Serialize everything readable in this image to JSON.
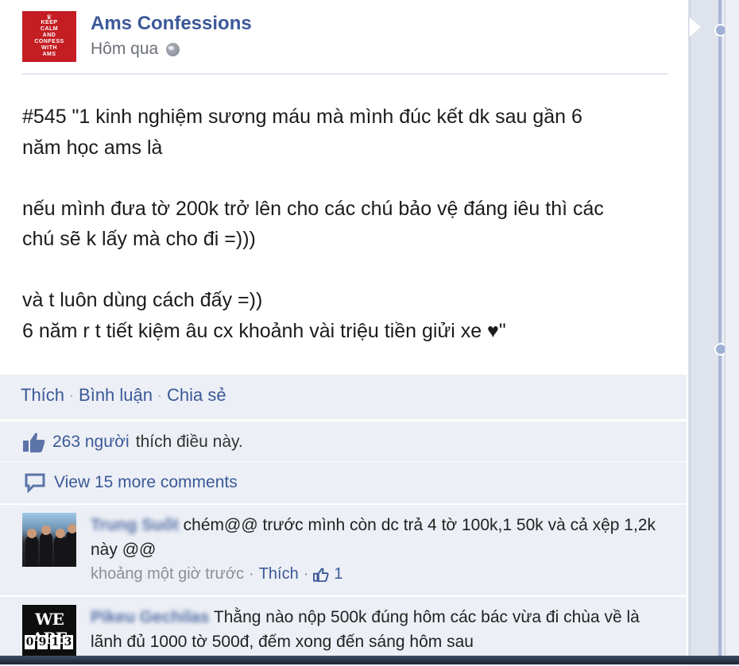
{
  "post": {
    "page_name": "Ams Confessions",
    "timestamp": "Hôm qua",
    "privacy_icon": "globe-icon",
    "logo_lines": [
      "KEEP",
      "CALM",
      "AND",
      "CONFESS",
      "WITH",
      "AMS"
    ],
    "text_lines": [
      "#545 \"1 kinh nghiệm sương máu mà mình đúc kết dk sau gần 6",
      "năm học ams là",
      "",
      "nếu mình đưa tờ 200k trở lên cho các chú bảo vệ đáng iêu thì các",
      "chú sẽ k lấy mà cho đi =)))",
      "",
      "và t luôn dùng cách đấy =))",
      "6 năm r t tiết kiệm âu cx khoảnh vài triệu tiền giửi xe ♥\""
    ]
  },
  "actions": {
    "like": "Thích",
    "comment": "Bình luận",
    "share": "Chia sẻ"
  },
  "likes": {
    "icon": "thumbs-up-icon",
    "count_label": "263 người",
    "suffix": "thích điều này."
  },
  "more_comments": {
    "icon": "comment-bubble-icon",
    "label": "View 15 more comments"
  },
  "comments": [
    {
      "author": "Trung Suốt",
      "text": "chém@@ trước mình còn dc trả 4 tờ 100k,1 50k và cả xệp 1,2k này @@",
      "time": "khoảng một giờ trước",
      "like_label": "Thích",
      "like_count": "1"
    },
    {
      "author": "Pikeu Gechilas",
      "text": "Thằng nào nộp 500k đúng hôm các bác vừa đi chùa về là lãnh đủ 1000 tờ 500đ, đếm xong đến sáng hôm sau",
      "avatar_text": "WE ARE",
      "avatar_digits": [
        "0",
        "9",
        "1",
        "3"
      ]
    }
  ],
  "colors": {
    "brand": "#3b5998",
    "logo_red": "#c41d22",
    "bar_bg": "#eceff5"
  }
}
